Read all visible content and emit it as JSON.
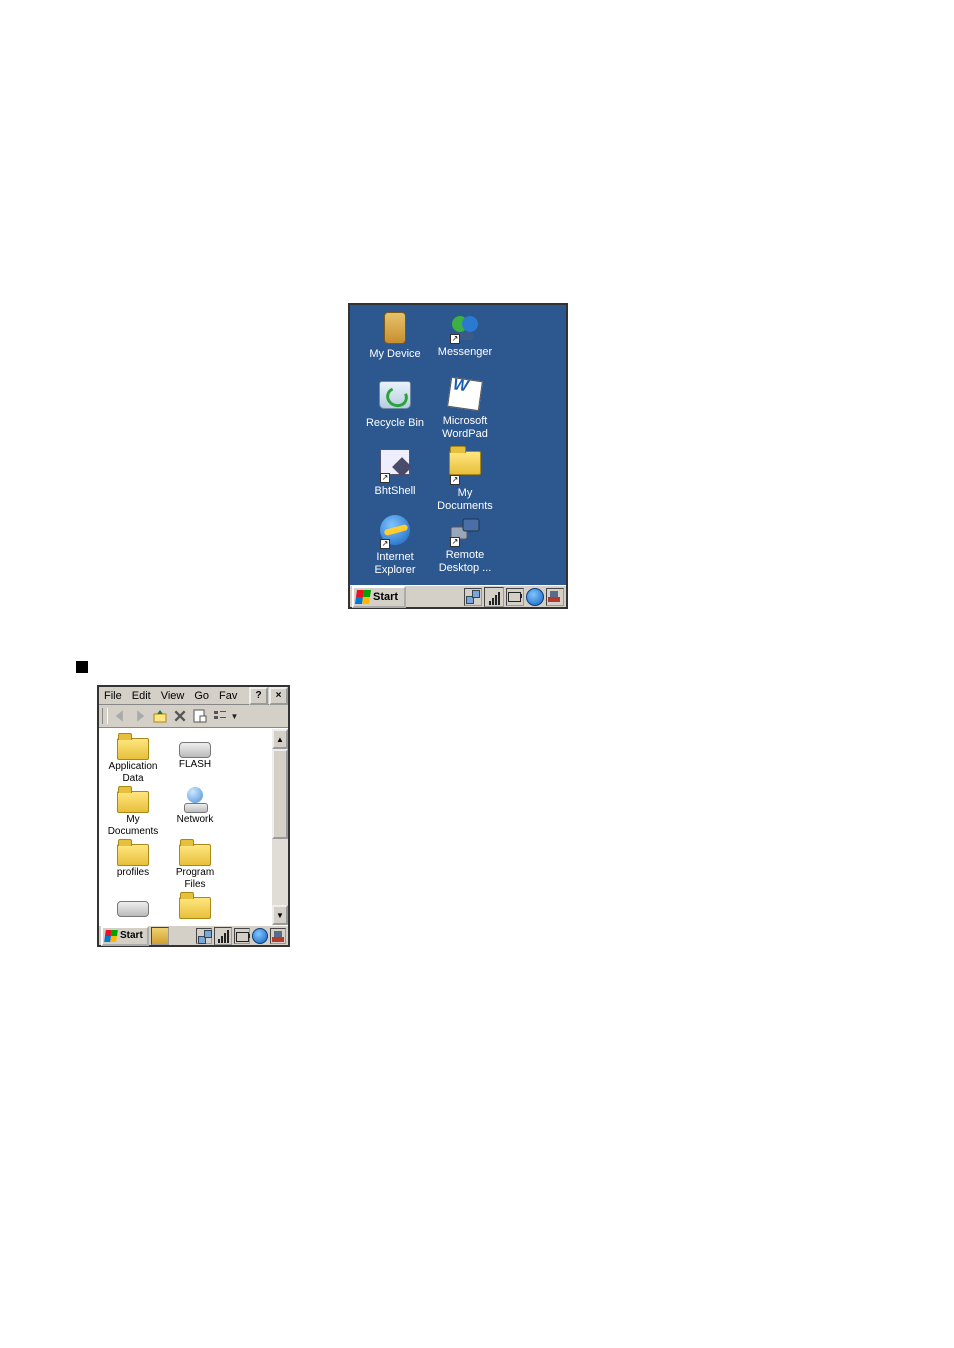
{
  "desktop": {
    "icons": [
      {
        "name": "my-device",
        "label": "My Device",
        "row": 0,
        "col": 0,
        "kind": "device",
        "shortcut": false
      },
      {
        "name": "messenger",
        "label": "Messenger",
        "row": 0,
        "col": 1,
        "kind": "messenger",
        "shortcut": true
      },
      {
        "name": "recycle-bin",
        "label": "Recycle Bin",
        "row": 1,
        "col": 0,
        "kind": "recycle",
        "shortcut": false
      },
      {
        "name": "microsoft-wordpad",
        "label": "Microsoft\nWordPad",
        "row": 1,
        "col": 1,
        "kind": "wordpad",
        "shortcut": false
      },
      {
        "name": "bhtshell",
        "label": "BhtShell",
        "row": 2,
        "col": 0,
        "kind": "bhtshell",
        "shortcut": true
      },
      {
        "name": "my-documents",
        "label": "My\nDocuments",
        "row": 2,
        "col": 1,
        "kind": "folder",
        "shortcut": true
      },
      {
        "name": "internet-explorer",
        "label": "Internet\nExplorer",
        "row": 3,
        "col": 0,
        "kind": "ie",
        "shortcut": true
      },
      {
        "name": "remote-desktop",
        "label": "Remote\nDesktop ...",
        "row": 3,
        "col": 1,
        "kind": "remote",
        "shortcut": true
      }
    ],
    "start_label": "Start",
    "tray": [
      "network-icon",
      "signal-icon",
      "battery-icon",
      "ie-icon",
      "connection-icon"
    ]
  },
  "explorer": {
    "menus": [
      "File",
      "Edit",
      "View",
      "Go",
      "Fav"
    ],
    "help_btn": "?",
    "close_btn": "×",
    "toolbar": [
      "back",
      "forward",
      "up",
      "delete",
      "properties",
      "views"
    ],
    "items": [
      {
        "name": "application-data",
        "label": "Application\nData",
        "kind": "folder",
        "row": 0,
        "col": 0
      },
      {
        "name": "flash",
        "label": "FLASH",
        "kind": "drive",
        "row": 0,
        "col": 1
      },
      {
        "name": "my-documents-f",
        "label": "My\nDocuments",
        "kind": "folder",
        "row": 1,
        "col": 0
      },
      {
        "name": "network",
        "label": "Network",
        "kind": "network",
        "row": 1,
        "col": 1
      },
      {
        "name": "profiles",
        "label": "profiles",
        "kind": "folder",
        "row": 2,
        "col": 0
      },
      {
        "name": "program-files",
        "label": "Program Files",
        "kind": "folder",
        "row": 2,
        "col": 1
      },
      {
        "name": "drive-2",
        "label": "",
        "kind": "drive",
        "row": 3,
        "col": 0
      },
      {
        "name": "folder-extra",
        "label": "",
        "kind": "folder",
        "row": 3,
        "col": 1
      }
    ],
    "start_label": "Start",
    "tray": [
      "network-icon",
      "signal-icon",
      "battery-icon",
      "ie-icon",
      "connection-icon"
    ]
  }
}
